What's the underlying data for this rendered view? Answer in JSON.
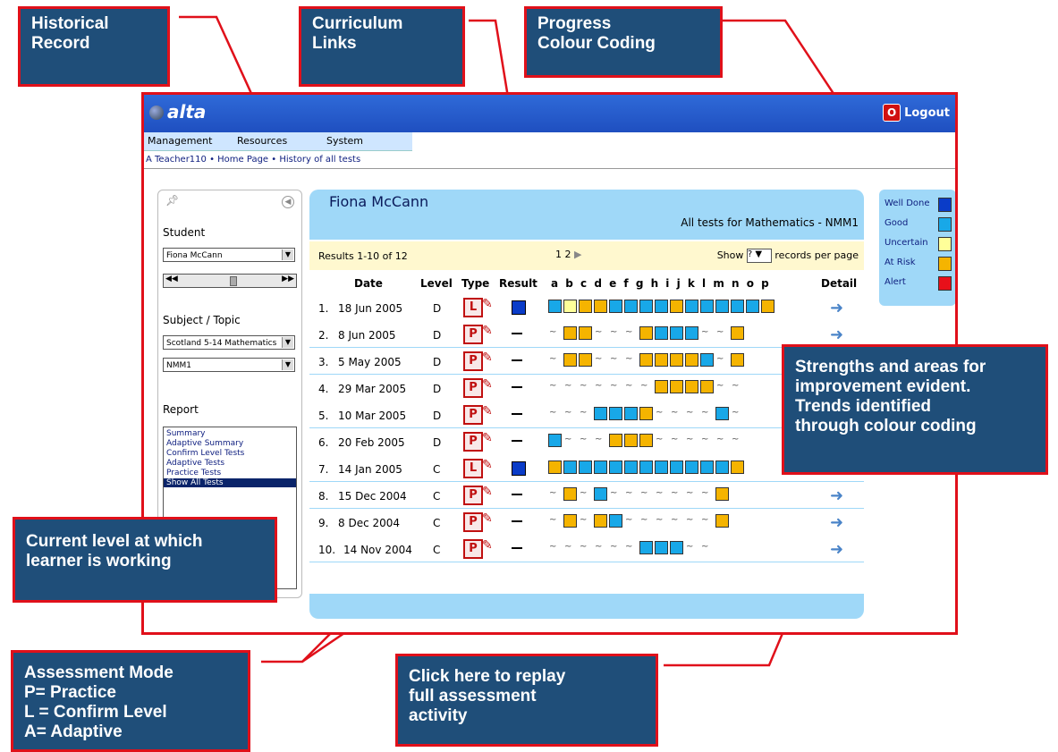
{
  "app": {
    "title": "alta",
    "logout_label": "Logout"
  },
  "menu": [
    "Management",
    "Resources",
    "System"
  ],
  "breadcrumb": "A Teacher110 • Home Page • History of all tests",
  "left_panel": {
    "student_heading": "Student",
    "student_value": "Fiona McCann",
    "subject_heading": "Subject / Topic",
    "subject_value": "Scotland 5-14 Mathematics",
    "topic_value": "NMM1",
    "report_heading": "Report",
    "report_items": [
      "Summary",
      "Adaptive Summary",
      "Confirm Level Tests",
      "Adaptive Tests",
      "Practice Tests",
      "Show All Tests"
    ],
    "selected_report": "Show All Tests"
  },
  "main": {
    "student_name": "Fiona McCann",
    "all_tests_title": "All tests for Mathematics - NMM1",
    "results_text": "Results 1-10 of 12",
    "pages_text": "1 2",
    "show_label": "Show",
    "show_value": "?",
    "records_label": "records per page",
    "headers": {
      "date": "Date",
      "level": "Level",
      "type": "Type",
      "result": "Result",
      "letters": "a b c d e f g h i j k l m n o p",
      "detail": "Detail"
    }
  },
  "colors": {
    "well_done": "#0a3cc8",
    "good": "#18a8e8",
    "uncertain": "#ffff99",
    "at_risk": "#f5b400",
    "alert": "#e8101a",
    "na": "~"
  },
  "legend": [
    {
      "label": "Well Done",
      "key": "well_done"
    },
    {
      "label": "Good",
      "key": "good"
    },
    {
      "label": "Uncertain",
      "key": "uncertain"
    },
    {
      "label": "At Risk",
      "key": "at_risk"
    },
    {
      "label": "Alert",
      "key": "alert"
    }
  ],
  "tests": [
    {
      "n": "1.",
      "date": "18 Jun 2005",
      "level": "D",
      "type": "L",
      "result": "well_done",
      "codes": [
        "G",
        "U",
        "R",
        "R",
        "G",
        "G",
        "G",
        "G",
        "R",
        "G",
        "G",
        "G",
        "G",
        "G",
        "R"
      ]
    },
    {
      "n": "2.",
      "date": "8 Jun 2005",
      "level": "D",
      "type": "P",
      "result": "dash",
      "codes": [
        "~",
        "R",
        "R",
        "~",
        "~",
        "~",
        "R",
        "G",
        "G",
        "G",
        "~",
        "~",
        "R"
      ]
    },
    {
      "n": "3.",
      "date": "5 May 2005",
      "level": "D",
      "type": "P",
      "result": "dash",
      "codes": [
        "~",
        "R",
        "R",
        "~",
        "~",
        "~",
        "R",
        "R",
        "R",
        "R",
        "G",
        "~",
        "R"
      ]
    },
    {
      "n": "4.",
      "date": "29 Mar 2005",
      "level": "D",
      "type": "P",
      "result": "dash",
      "codes": [
        "~",
        "~",
        "~",
        "~",
        "~",
        "~",
        "~",
        "R",
        "R",
        "R",
        "R",
        "~",
        "~"
      ]
    },
    {
      "n": "5.",
      "date": "10 Mar 2005",
      "level": "D",
      "type": "P",
      "result": "dash",
      "codes": [
        "~",
        "~",
        "~",
        "G",
        "G",
        "G",
        "R",
        "~",
        "~",
        "~",
        "~",
        "G",
        "~"
      ]
    },
    {
      "n": "6.",
      "date": "20 Feb 2005",
      "level": "D",
      "type": "P",
      "result": "dash",
      "codes": [
        "G",
        "~",
        "~",
        "~",
        "R",
        "R",
        "R",
        "~",
        "~",
        "~",
        "~",
        "~",
        "~"
      ]
    },
    {
      "n": "7.",
      "date": "14 Jan 2005",
      "level": "C",
      "type": "L",
      "result": "well_done",
      "codes": [
        "R",
        "G",
        "G",
        "G",
        "G",
        "G",
        "G",
        "G",
        "G",
        "G",
        "G",
        "G",
        "R"
      ]
    },
    {
      "n": "8.",
      "date": "15 Dec 2004",
      "level": "C",
      "type": "P",
      "result": "dash",
      "codes": [
        "~",
        "R",
        "~",
        "G",
        "~",
        "~",
        "~",
        "~",
        "~",
        "~",
        "~",
        "R"
      ]
    },
    {
      "n": "9.",
      "date": "8 Dec 2004",
      "level": "C",
      "type": "P",
      "result": "dash",
      "codes": [
        "~",
        "R",
        "~",
        "R",
        "G",
        "~",
        "~",
        "~",
        "~",
        "~",
        "~",
        "R"
      ]
    },
    {
      "n": "10.",
      "date": "14 Nov 2004",
      "level": "C",
      "type": "P",
      "result": "dash",
      "codes": [
        "~",
        "~",
        "~",
        "~",
        "~",
        "~",
        "G",
        "G",
        "G",
        "~",
        "~"
      ]
    }
  ],
  "callouts": {
    "historical": "Historical\nRecord",
    "curriculum": "Curriculum\nLinks",
    "progress": "Progress\nColour Coding",
    "strengths": "Strengths and areas for\nimprovement evident.\nTrends identified\nthrough colour coding",
    "current_level": "Current  level at which\nlearner is working",
    "assessment": "Assessment  Mode\nP= Practice\nL = Confirm Level\nA= Adaptive",
    "replay": "Click here to replay\nfull assessment\nactivity"
  }
}
